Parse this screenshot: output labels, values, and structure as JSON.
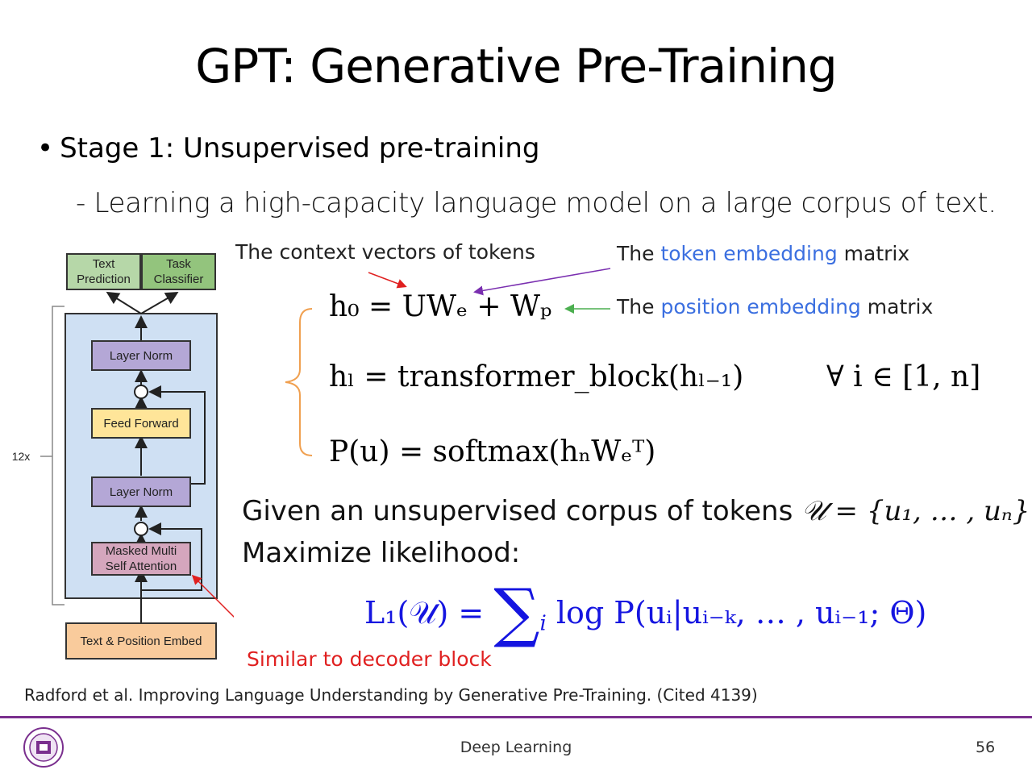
{
  "slide": {
    "title": "GPT: Generative Pre-Training",
    "bullet_symbol": "•",
    "bullet": "Stage 1: Unsupervised pre-training",
    "subpoint": "- Learning a high-capacity language model on a large corpus of text."
  },
  "annotations": {
    "context_vectors": "The context vectors of tokens",
    "token_embedding_pre": "The",
    "token_embedding_hl": "token embedding",
    "token_embedding_post": "matrix",
    "position_embedding_pre": "The",
    "position_embedding_hl": "position embedding",
    "position_embedding_post": "matrix",
    "decoder_note": "Similar to decoder block"
  },
  "equations": {
    "eq1": "h₀ = UWₑ + Wₚ",
    "eq2": "hₗ = transformer_block(hₗ₋₁)",
    "eq2_cond": "∀ i  ∈ [1, n]",
    "eq3": "P(u) = softmax(hₙWₑᵀ)"
  },
  "corpus": {
    "given": "Given an unsupervised corpus of tokens",
    "set_expr": "𝒰 = {u₁, … , uₙ}",
    "maximize": "Maximize likelihood:"
  },
  "likelihood": {
    "lhs": "L₁(𝒰) =",
    "sum": "∑",
    "sum_index": "i",
    "rhs": "log P(uᵢ|uᵢ₋ₖ, … , uᵢ₋₁; Θ)"
  },
  "diagram": {
    "top_left": "Text Prediction",
    "top_right": "Task Classifier",
    "layer_norm_top": "Layer Norm",
    "feed_forward": "Feed Forward",
    "layer_norm_bottom": "Layer Norm",
    "masked_attention": "Masked Multi Self Attention",
    "embed": "Text & Position Embed",
    "repeat": "12x",
    "plus": "+"
  },
  "citation": "Radford et al. Improving Language Understanding by Generative Pre-Training. (Cited 4139)",
  "footer": {
    "course": "Deep Learning",
    "page": "56"
  },
  "colors": {
    "accent_purple": "#7a2f8e",
    "link_blue": "#3b6fe0",
    "formula_blue": "#1515e0",
    "note_red": "#e02020",
    "brace_orange": "#f0a050"
  }
}
